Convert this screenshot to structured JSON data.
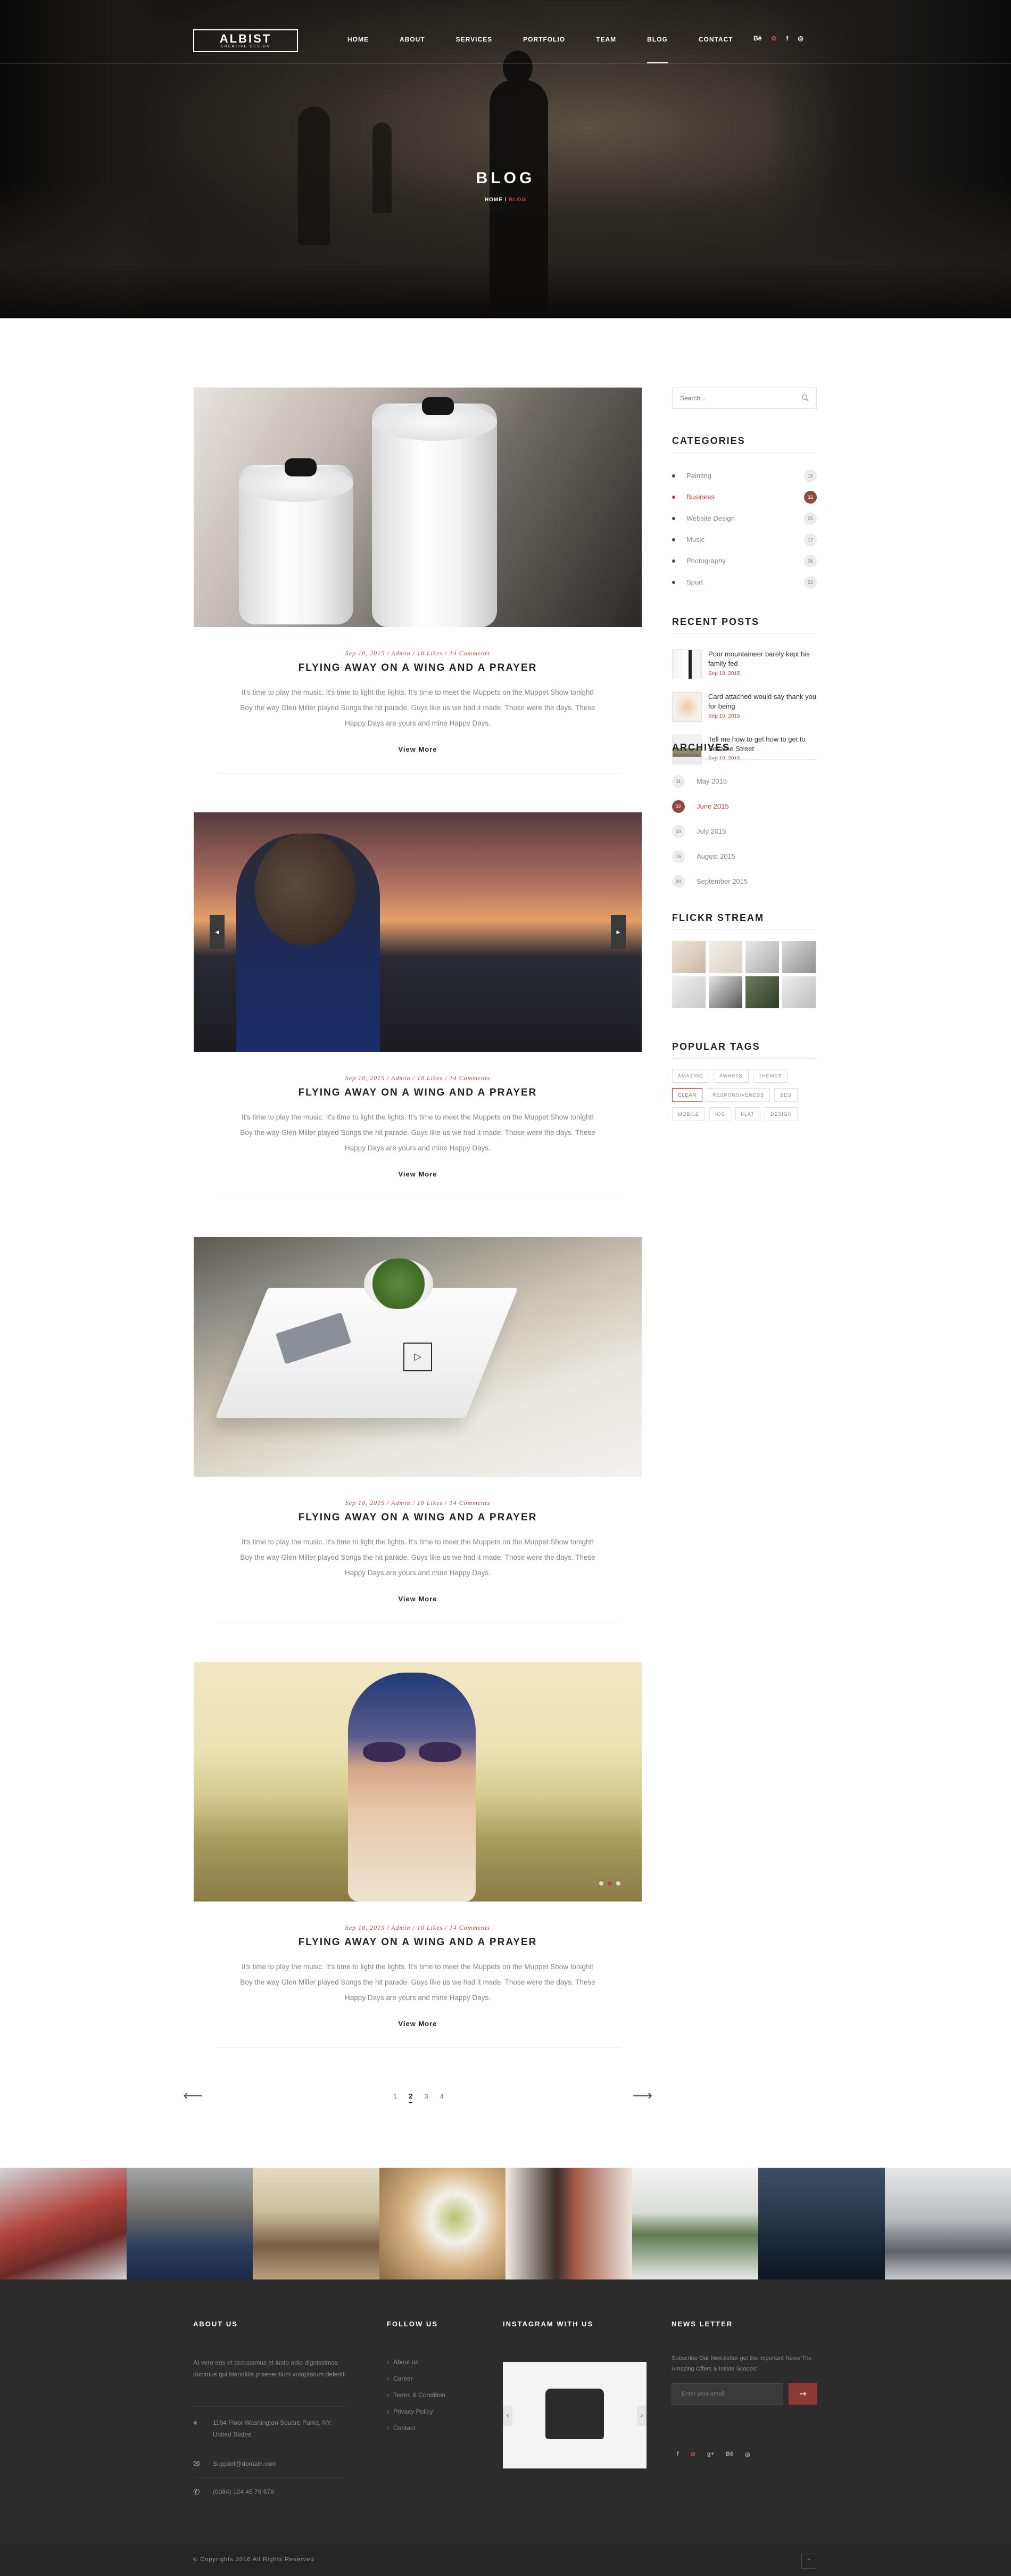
{
  "header": {
    "logo_name": "ALBIST",
    "logo_tagline": "CREATIVE DESIGN",
    "nav": [
      "HOME",
      "ABOUT",
      "SERVICES",
      "PORTFOLIO",
      "TEAM",
      "BLOG",
      "CONTACT"
    ],
    "active_nav": "BLOG",
    "social": [
      "Bē",
      "✿",
      "f",
      "◎"
    ]
  },
  "hero": {
    "title": "BLOG",
    "breadcrumb_home": "HOME",
    "breadcrumb_sep": "/",
    "breadcrumb_current": "BLOG"
  },
  "posts": [
    {
      "date": "Sep 10, 2015",
      "author": "Admin",
      "likes": "10 Likes",
      "comments": "14 Comments",
      "title": "FLYING AWAY ON A WING AND A PRAYER",
      "excerpt": "It's time to play the music. It's time to light the lights. It's time to meet the Muppets on the Muppet Show tonight! Boy the way Glen Miller played Songs the hit parade. Guys like us we had it made. Those were the days. These Happy Days are yours and mine Happy Days.",
      "more": "View More"
    },
    {
      "date": "Sep 10, 2015",
      "author": "Admin",
      "likes": "10 Likes",
      "comments": "14 Comments",
      "title": "FLYING AWAY ON A WING AND A PRAYER",
      "excerpt": "It's time to play the music. It's time to light the lights. It's time to meet the Muppets on the Muppet Show tonight! Boy the way Glen Miller played Songs the hit parade. Guys like us we had it made. Those were the days. These Happy Days are yours and mine Happy Days.",
      "more": "View More"
    },
    {
      "date": "Sep 10, 2015",
      "author": "Admin",
      "likes": "10 Likes",
      "comments": "14 Comments",
      "title": "FLYING AWAY ON A WING AND A PRAYER",
      "excerpt": "It's time to play the music. It's time to light the lights. It's time to meet the Muppets on the Muppet Show tonight! Boy the way Glen Miller played Songs the hit parade. Guys like us we had it made. Those were the days. These Happy Days are yours and mine Happy Days.",
      "more": "View More"
    },
    {
      "date": "Sep 10, 2015",
      "author": "Admin",
      "likes": "10 Likes",
      "comments": "14 Comments",
      "title": "FLYING AWAY ON A WING AND A PRAYER",
      "excerpt": "It's time to play the music. It's time to light the lights. It's time to meet the Muppets on the Muppet Show tonight! Boy the way Glen Miller played Songs the hit parade. Guys like us we had it made. Those were the days. These Happy Days are yours and mine Happy Days.",
      "more": "View More"
    }
  ],
  "pagination": {
    "prev": "⟵",
    "next": "⟶",
    "pages": [
      "1",
      "2",
      "3",
      "4"
    ],
    "current": "2"
  },
  "sidebar": {
    "search_placeholder": "Search...",
    "categories_title": "CATEGORIES",
    "categories": [
      {
        "label": "Painting",
        "count": "15"
      },
      {
        "label": "Business",
        "count": "32"
      },
      {
        "label": "Website Design",
        "count": "25"
      },
      {
        "label": "Music",
        "count": "12"
      },
      {
        "label": "Photography",
        "count": "06"
      },
      {
        "label": "Sport",
        "count": "22"
      }
    ],
    "active_category": "Business",
    "recent_title": "RECENT POSTS",
    "recent": [
      {
        "title": "Poor mountaineer barely kept his family fed",
        "date": "Sep 10, 2015"
      },
      {
        "title": "Card attached would say thank you for being",
        "date": "Sep 10, 2015"
      },
      {
        "title": "Tell me how to get how to get to Sesame Street",
        "date": "Sep 10, 2015"
      }
    ],
    "archives_title": "ARCHIVES",
    "archives": [
      {
        "label": "May 2015",
        "count": "11"
      },
      {
        "label": "June 2015",
        "count": "32"
      },
      {
        "label": "July 2015",
        "count": "03"
      },
      {
        "label": "August 2015",
        "count": "15"
      },
      {
        "label": "September 2015",
        "count": "20"
      }
    ],
    "active_archive": "June 2015",
    "flickr_title": "FLICKR STREAM",
    "tags_title": "POPULAR TAGS",
    "tags": [
      "AMAZING",
      "AWARTS",
      "THEMES",
      "CLEAN",
      "RESPONSIVENESS",
      "SEO",
      "MOBILE",
      "IOS",
      "FLAT",
      "DESIGN"
    ],
    "active_tag": "CLEAN"
  },
  "footer": {
    "about_title": "ABOUT US",
    "about_text": "At vero eos et accusamus et iusto odio dignissimos ducimus qui blanditiis praesentium voluptatum deleniti",
    "address": "1184 Floor Washington Square Parks, NY, United States",
    "email": "Support@domain.com",
    "phone": "(0084) 124 45 78 678",
    "follow_title": "FOLLOW US",
    "follow_links": [
      "About us",
      "Career",
      "Terms & Condition",
      "Privacy Policy",
      "Contact"
    ],
    "instagram_title": "INSTAGRAM WITH US",
    "newsletter_title": "NEWS LETTER",
    "newsletter_text": "Subscribe Our Newsletter get the important News The Amazing Offers & Inside Scoops:",
    "newsletter_placeholder": "Enter your email",
    "newsletter_button": "→",
    "social": [
      "f",
      "✿",
      "g+",
      "Bē",
      "◎"
    ],
    "copyright": "© Copyrights 2016 All Rights Reserved",
    "up_icon": "⌃"
  }
}
